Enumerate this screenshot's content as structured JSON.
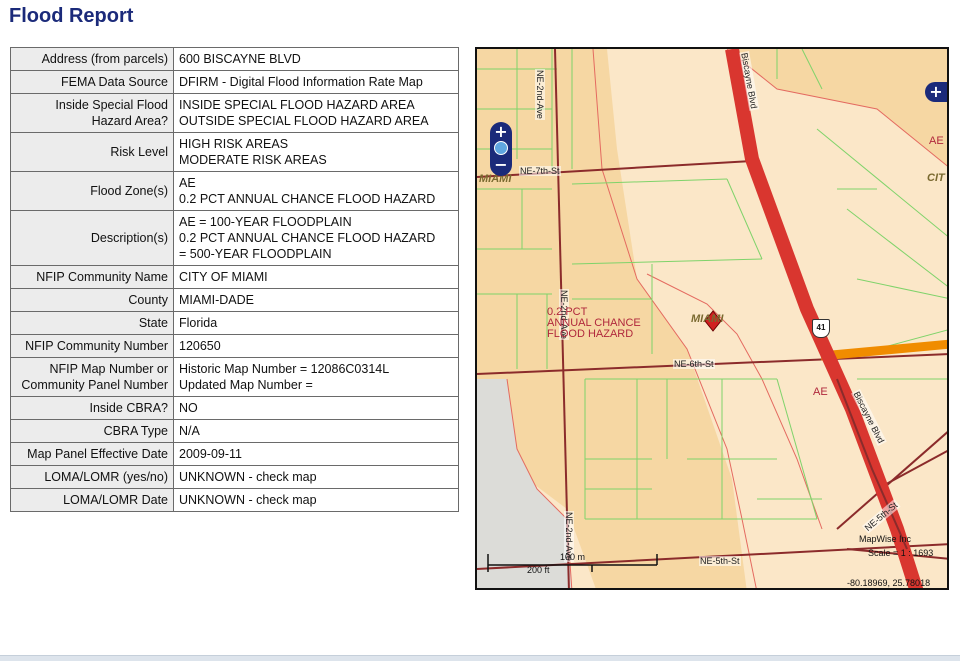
{
  "title": "Flood Report",
  "rows": [
    {
      "label": "Address (from parcels)",
      "value": [
        "600 BISCAYNE BLVD"
      ]
    },
    {
      "label": "FEMA Data Source",
      "value": [
        "DFIRM - Digital Flood Information Rate Map"
      ]
    },
    {
      "label": "Inside Special Flood Hazard Area?",
      "value": [
        "INSIDE SPECIAL FLOOD HAZARD AREA",
        "OUTSIDE SPECIAL FLOOD HAZARD AREA"
      ]
    },
    {
      "label": "Risk Level",
      "value": [
        "HIGH RISK AREAS",
        "MODERATE RISK AREAS"
      ]
    },
    {
      "label": "Flood Zone(s)",
      "value": [
        "AE",
        "0.2 PCT ANNUAL CHANCE FLOOD HAZARD"
      ]
    },
    {
      "label": "Description(s)",
      "value": [
        "AE = 100-YEAR FLOODPLAIN",
        "0.2 PCT ANNUAL CHANCE FLOOD HAZARD",
        "= 500-YEAR FLOODPLAIN"
      ]
    },
    {
      "label": "NFIP Community Name",
      "value": [
        "CITY OF MIAMI"
      ]
    },
    {
      "label": "County",
      "value": [
        "MIAMI-DADE"
      ]
    },
    {
      "label": "State",
      "value": [
        "Florida"
      ]
    },
    {
      "label": "NFIP Community Number",
      "value": [
        "120650"
      ]
    },
    {
      "label": "NFIP Map Number or Community Panel Number",
      "value": [
        "Historic Map Number = 12086C0314L",
        "Updated Map Number ="
      ]
    },
    {
      "label": "Inside CBRA?",
      "value": [
        "NO"
      ]
    },
    {
      "label": "CBRA Type",
      "value": [
        "N/A"
      ]
    },
    {
      "label": "Map Panel Effective Date",
      "value": [
        "2009-09-11"
      ]
    },
    {
      "label": "LOMA/LOMR (yes/no)",
      "value": [
        "UNKNOWN - check map"
      ]
    },
    {
      "label": "LOMA/LOMR Date",
      "value": [
        "UNKNOWN - check map"
      ]
    }
  ],
  "map": {
    "zoom_in": "+",
    "zoom_out": "−",
    "expand": "+",
    "streets": {
      "ne2ndave_top": "NE-2nd-Ave",
      "biscayne_top": "Biscayne Blvd",
      "ne7thst": "NE-7th-St",
      "ne2ndave_mid": "NE-2nd-Ave",
      "ne6thst": "NE-6th-St",
      "biscayne_mid": "Biscayne Blvd",
      "ne5thst_right": "NE-5th-St",
      "ne2ndave_bottom": "NE-2nd-Ave",
      "ne5thst_bottom": "NE-5th-St"
    },
    "city_labels": {
      "left": "MIAMI",
      "center": "MIAMI",
      "right": "CIT"
    },
    "zone_labels": {
      "ae_top": "AE",
      "ae_mid": "AE",
      "pct": [
        "0.2 PCT",
        "ANNUAL CHANCE",
        "FLOOD HAZARD"
      ]
    },
    "route_shield": "41",
    "scale_m": "100 m",
    "scale_ft": "200 ft",
    "attribution": "MapWise Inc",
    "scale_text": "Scale = 1 : 1693",
    "coords": "-80.18969, 25.78018",
    "colors": {
      "hazard": "#f6d7a3",
      "moderate": "#fbe7c8",
      "road": "#d9362f",
      "minor_road": "#8b2b2b",
      "highway": "#f08c00",
      "parcel": "#7fd36a",
      "zone_line": "#e46a60"
    }
  }
}
